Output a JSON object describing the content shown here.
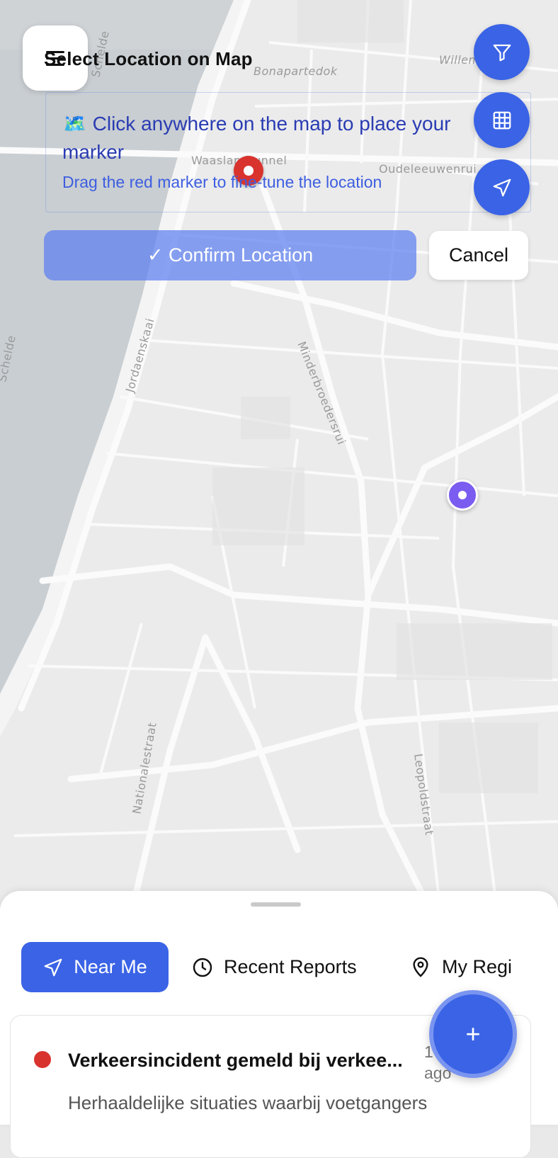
{
  "header": {
    "menu_icon": "hamburger-menu-icon",
    "title": "Select Location on Map"
  },
  "instructions": {
    "icon": "map-emoji-icon",
    "main": "🗺️ Click anywhere on the map to place your marker",
    "sub": "Drag the red marker to fine-tune the location"
  },
  "actions": {
    "confirm_label": "✓ Confirm Location",
    "cancel_label": "Cancel"
  },
  "map_controls": [
    {
      "name": "filter-icon"
    },
    {
      "name": "grid-icon"
    },
    {
      "name": "navigate-icon"
    }
  ],
  "map": {
    "street_labels": [
      "Bonapartedok",
      "Willem",
      "Waaslandtunnel",
      "Oudeleeuwenrui",
      "Schelde",
      "Jordaenskaai",
      "Minderbroedersrui",
      "Nationalestraat",
      "Leopoldstraat",
      "Schelde"
    ]
  },
  "bottom_sheet": {
    "tabs": [
      {
        "label": "Near Me",
        "icon": "navigate-icon",
        "active": true
      },
      {
        "label": "Recent Reports",
        "icon": "clock-icon",
        "active": false
      },
      {
        "label": "My Regi",
        "icon": "location-pin-icon",
        "active": false
      }
    ],
    "report": {
      "title": "Verkeersincident gemeld bij verkee...",
      "time": "1 ago",
      "description": "Herhaaldelijke situaties waarbij voetgangers",
      "status_color": "#d9332e"
    },
    "add_button_label": "+"
  },
  "colors": {
    "accent": "#3a63e6",
    "marker_red": "#d9332e",
    "user_dot": "#7b5cf0"
  }
}
